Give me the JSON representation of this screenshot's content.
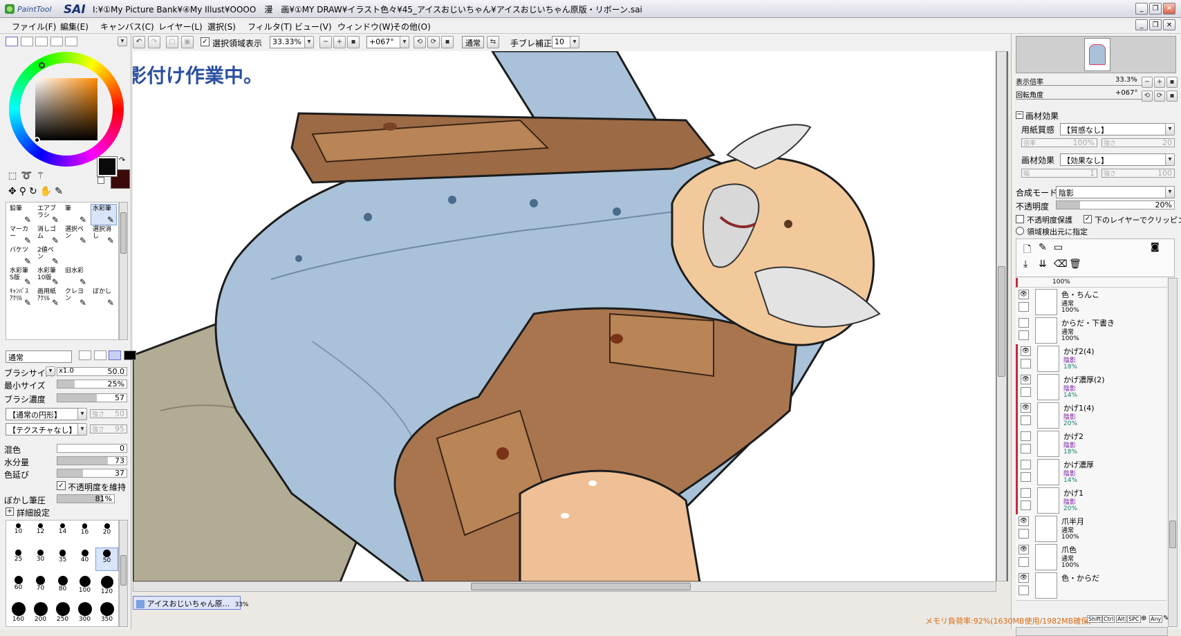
{
  "window": {
    "app_logo": "PaintTool SAI",
    "title": "I:¥①My Picture Bank¥④My Illust¥OOOO　漫　画¥①MY DRAW¥イラスト色々¥45_アイスおじいちゃん¥アイスおじいちゃん原版・リボーン.sai"
  },
  "menu": [
    "ファイル(F)",
    "編集(E)",
    "キャンバス(C)",
    "レイヤー(L)",
    "選択(S)",
    "フィルタ(T)",
    "ビュー(V)",
    "ウィンドウ(W)",
    "その他(O)"
  ],
  "toolbar": {
    "selection_display": "選択領域表示",
    "zoom": "33.33%",
    "rotation": "+067°",
    "blend": "通常",
    "stabilizer_label": "手ブレ補正",
    "stabilizer_value": "10"
  },
  "canvas": {
    "overlay_text": "影付け作業中。"
  },
  "tools": {
    "items": [
      {
        "label": "鉛筆",
        "selected": false
      },
      {
        "label": "エアブラシ",
        "selected": false
      },
      {
        "label": "筆",
        "selected": false
      },
      {
        "label": "水彩筆",
        "selected": true
      },
      {
        "label": "マーカー",
        "selected": false
      },
      {
        "label": "消しゴム",
        "selected": false
      },
      {
        "label": "選択ペン",
        "selected": false
      },
      {
        "label": "選択消し",
        "selected": false
      },
      {
        "label": "バケツ",
        "selected": false
      },
      {
        "label": "2値ペン",
        "selected": false
      },
      {
        "label": "",
        "selected": false
      },
      {
        "label": "",
        "selected": false
      },
      {
        "label": "水彩筆 S版",
        "selected": false
      },
      {
        "label": "水彩筆 10版",
        "selected": false
      },
      {
        "label": "旧水彩",
        "selected": false
      },
      {
        "label": "",
        "selected": false
      },
      {
        "label": "ｷｬﾝﾊﾞｽ ｱｸﾘﾙ",
        "selected": false
      },
      {
        "label": "画用紙 ｱｸﾘﾙ",
        "selected": false
      },
      {
        "label": "クレヨン",
        "selected": false
      },
      {
        "label": "ぼかし",
        "selected": false
      }
    ]
  },
  "brush": {
    "mode": "通常",
    "size_label": "ブラシサイズ",
    "size_mult": "x1.0",
    "size_value": "50.0",
    "min_size_label": "最小サイズ",
    "min_size_value": "25%",
    "min_size_fraction": 0.25,
    "density_label": "ブラシ濃度",
    "density_value": "57",
    "density_fraction": 0.57,
    "shape": "【通常の円形】",
    "shape_strength": "強さ",
    "shape_strength_value": "50",
    "texture": "【テクスチャなし】",
    "texture_strength": "強さ",
    "texture_strength_value": "95",
    "blend_label": "混色",
    "blend_value": "0",
    "blend_fraction": 0.0,
    "water_label": "水分量",
    "water_value": "73",
    "water_fraction": 0.73,
    "stretch_label": "色延び",
    "stretch_value": "37",
    "stretch_fraction": 0.37,
    "keep_opacity": "不透明度を維持",
    "blur_label": "ぼかし筆圧",
    "blur_value": "81%",
    "blur_fraction": 0.81,
    "advanced": "詳細設定"
  },
  "brush_sizes": [
    "10",
    "12",
    "14",
    "16",
    "20",
    "25",
    "30",
    "35",
    "40",
    "50",
    "60",
    "70",
    "80",
    "100",
    "120",
    "160",
    "200",
    "250",
    "300",
    "350"
  ],
  "brush_selected": "50",
  "navigator": {
    "zoom_label": "表示倍率",
    "zoom_value": "33.3%",
    "rotate_label": "回転角度",
    "rotate_value": "+067°"
  },
  "material": {
    "header": "画材効果",
    "paper_label": "用紙質感",
    "paper_value": "【質感なし】",
    "paper_scale_label": "倍率",
    "paper_scale": "100%",
    "paper_strength_label": "強さ",
    "paper_strength": "20",
    "effect_label": "画材効果",
    "effect_value": "【効果なし】",
    "effect_width_label": "幅",
    "effect_width": "1",
    "effect_strength_label": "強さ",
    "effect_strength": "100"
  },
  "layer_props": {
    "blend_label": "合成モード",
    "blend_value": "陰影",
    "opacity_label": "不透明度",
    "opacity_value": "20%",
    "opacity_fraction": 0.2,
    "protect": "不透明度保護",
    "clip": "下のレイヤーでクリッピング",
    "selection_source": "領域検出元に指定"
  },
  "layers": [
    {
      "name": "色・ちんこ",
      "mode": "通常",
      "opacity": "100%",
      "visible": true,
      "style": "normal"
    },
    {
      "name": "からだ・下書き",
      "mode": "通常",
      "opacity": "100%",
      "visible": false,
      "style": "normal"
    },
    {
      "name": "かげ2(4)",
      "mode": "陰影",
      "opacity": "18%",
      "visible": true,
      "style": "clip"
    },
    {
      "name": "かげ濃厚(2)",
      "mode": "陰影",
      "opacity": "14%",
      "visible": true,
      "style": "clip"
    },
    {
      "name": "かげ1(4)",
      "mode": "陰影",
      "opacity": "20%",
      "visible": true,
      "style": "clip"
    },
    {
      "name": "かげ2",
      "mode": "陰影",
      "opacity": "18%",
      "visible": false,
      "style": "clip"
    },
    {
      "name": "かげ濃厚",
      "mode": "陰影",
      "opacity": "14%",
      "visible": false,
      "style": "clip"
    },
    {
      "name": "かげ1",
      "mode": "陰影",
      "opacity": "20%",
      "visible": false,
      "style": "clip"
    },
    {
      "name": "爪半月",
      "mode": "通常",
      "opacity": "100%",
      "visible": true,
      "style": "normal"
    },
    {
      "name": "爪色",
      "mode": "通常",
      "opacity": "100%",
      "visible": true,
      "style": "normal"
    },
    {
      "name": "色・からだ",
      "mode": "",
      "opacity": "",
      "visible": true,
      "style": "normal"
    }
  ],
  "layers_top_partial": "100%",
  "document_tab": {
    "name": "アイスおじいちゃん原...",
    "zoom": "33%"
  },
  "status": {
    "memory": "メモリ負荷率:92%(1630MB使用/1982MB確保)",
    "keys": [
      "Shift",
      "Ctrl",
      "Alt",
      "SPC"
    ],
    "any": "Any"
  },
  "colors": {
    "foreground": "#0a0a0a",
    "background": "#3a0a0a",
    "accent": "#6b5bd6",
    "purple_text": "#7a1aa2",
    "status_orange": "#d86a10",
    "overlay_text": "#2b4fa0"
  }
}
